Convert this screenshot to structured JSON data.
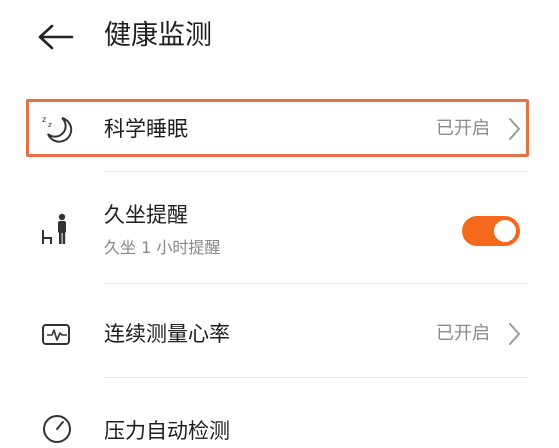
{
  "header": {
    "title": "健康监测"
  },
  "items": [
    {
      "label": "科学睡眠",
      "status": "已开启"
    },
    {
      "label": "久坐提醒",
      "sub": "久坐 1 小时提醒",
      "toggle_on": true
    },
    {
      "label": "连续测量心率",
      "status": "已开启"
    },
    {
      "label": "压力自动检测"
    }
  ],
  "colors": {
    "accent": "#f5691d",
    "highlight_border": "#e57244"
  }
}
